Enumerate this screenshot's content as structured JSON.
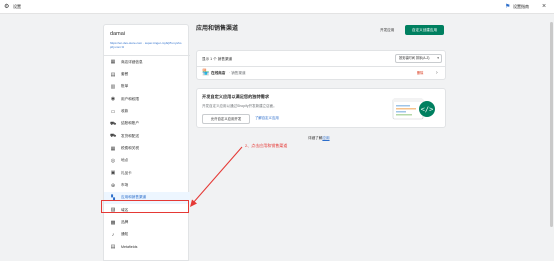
{
  "topbar": {
    "title": "设置",
    "setup_guide": "设置指南",
    "gear_icon": "gear-icon",
    "flag_icon": "flag-icon",
    "close_icon": "close-icon"
  },
  "sidebar": {
    "store_name": "damai",
    "store_url": "https://en.dev-store.com · super-tinger-mybrjt5.myshopify.com ⧉",
    "items": [
      {
        "label": "商店详细信息",
        "icon": "store-icon"
      },
      {
        "label": "套餐",
        "icon": "plan-icon"
      },
      {
        "label": "账单",
        "icon": "billing-icon"
      },
      {
        "label": "用户和权限",
        "icon": "user-icon"
      },
      {
        "label": "收款",
        "icon": "payment-icon"
      },
      {
        "label": "结账和账户",
        "icon": "checkout-icon"
      },
      {
        "label": "发货和配送",
        "icon": "truck-icon"
      },
      {
        "label": "税费和关税",
        "icon": "tax-icon"
      },
      {
        "label": "地点",
        "icon": "location-icon"
      },
      {
        "label": "礼品卡",
        "icon": "giftcard-icon"
      },
      {
        "label": "市场",
        "icon": "globe-icon"
      },
      {
        "label": "应用和销售渠道",
        "icon": "apps-icon",
        "active": true
      },
      {
        "label": "域名",
        "icon": "domain-icon"
      },
      {
        "label": "品牌",
        "icon": "brand-icon"
      },
      {
        "label": "通知",
        "icon": "bell-icon"
      },
      {
        "label": "Metafields",
        "icon": "metafields-icon"
      }
    ]
  },
  "main": {
    "title": "应用和销售渠道",
    "dev_button": "开发应用",
    "create_button": "自定义创建应用"
  },
  "channels": {
    "count_text": "显示 1 个 销售渠道",
    "sort_label": "按安装时间 排序(A-Z)",
    "items": [
      {
        "name": "在线商店",
        "sub": "· 销售渠道",
        "badge": "删除",
        "icon": "online-store-icon"
      }
    ]
  },
  "custom_card": {
    "title": "开发自定义应用以满足您的独特需求",
    "description": "开发自定义应用以通过Shopify开发新建立店面。",
    "button": "允许自定义应用开发",
    "link": "了解自定义应用"
  },
  "learn": {
    "prefix": "详细了解",
    "link": "应用"
  },
  "annotation": {
    "text": "2、点击应用和销售渠道",
    "color": "#e53935"
  },
  "colors": {
    "accent": "#008060",
    "link": "#2c6ecb",
    "highlight": "#e53935"
  }
}
